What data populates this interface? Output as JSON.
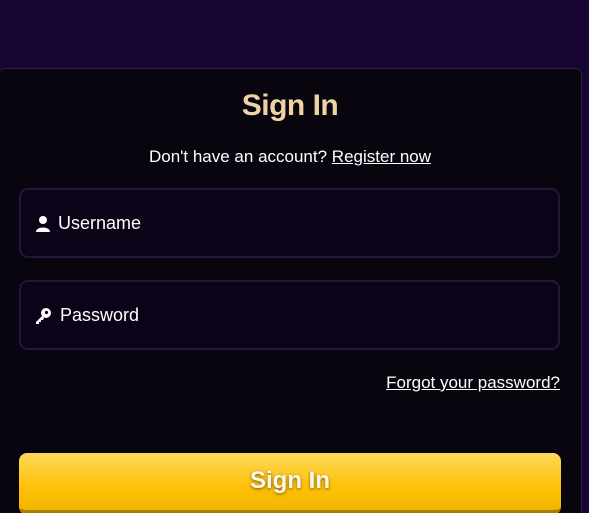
{
  "card": {
    "title": "Sign In",
    "register_prompt": "Don't have an account?",
    "register_link": "Register now"
  },
  "form": {
    "username_placeholder": "Username",
    "password_placeholder": "Password",
    "username_icon": "user-icon",
    "password_icon": "key-icon",
    "forgot_link": "Forgot your password?",
    "submit_label": "Sign In"
  },
  "colors": {
    "background": "#160432",
    "card": "#08050f",
    "title": "#efd3a3",
    "button": "#ffc107"
  }
}
